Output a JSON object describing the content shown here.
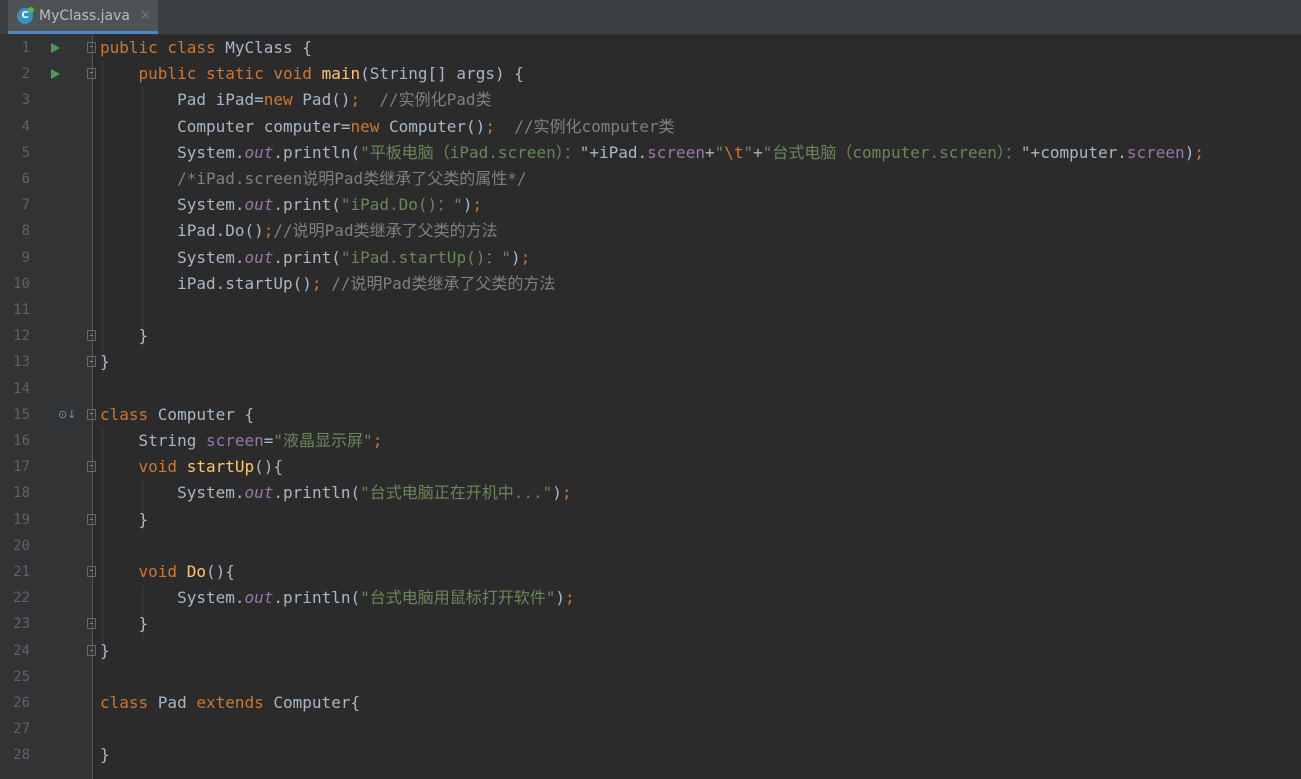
{
  "tab": {
    "label": "MyClass.java",
    "close": "×",
    "icon_letter": "C"
  },
  "colors": {
    "keyword": "#cc7832",
    "string": "#6a8759",
    "comment": "#808080",
    "field": "#9876aa",
    "method": "#ffc66d",
    "escape": "#cc7832",
    "default": "#a9b7c6"
  },
  "lines": [
    {
      "num": "1",
      "gutter": "run",
      "fold": "open",
      "tokens": [
        [
          "kw",
          "public class "
        ],
        [
          "d",
          "MyClass {"
        ]
      ]
    },
    {
      "num": "2",
      "gutter": "run",
      "fold": "open",
      "tokens": [
        [
          "d",
          "    "
        ],
        [
          "kw",
          "public static void "
        ],
        [
          "m",
          "main"
        ],
        [
          "d",
          "(String[] args) {"
        ]
      ]
    },
    {
      "num": "3",
      "tokens": [
        [
          "d",
          "        Pad iPad="
        ],
        [
          "kw",
          "new "
        ],
        [
          "d",
          "Pad()"
        ],
        [
          "kw",
          ";"
        ],
        [
          "d",
          "  "
        ],
        [
          "c",
          "//实例化Pad类"
        ]
      ]
    },
    {
      "num": "4",
      "tokens": [
        [
          "d",
          "        Computer computer="
        ],
        [
          "kw",
          "new "
        ],
        [
          "d",
          "Computer()"
        ],
        [
          "kw",
          ";"
        ],
        [
          "d",
          "  "
        ],
        [
          "c",
          "//实例化computer类"
        ]
      ]
    },
    {
      "num": "5",
      "tokens": [
        [
          "d",
          "        System."
        ],
        [
          "fi",
          "out"
        ],
        [
          "d",
          ".println("
        ],
        [
          "s",
          "\"平板电脑（iPad.screen）："
        ],
        [
          "d",
          "\"+iPad."
        ],
        [
          "f",
          "screen"
        ],
        [
          "d",
          "+"
        ],
        [
          "s",
          "\""
        ],
        [
          "e",
          "\\t"
        ],
        [
          "s",
          "\""
        ],
        [
          "d",
          "+"
        ],
        [
          "s",
          "\"台式电脑（computer.screen）："
        ],
        [
          "d",
          "\"+computer."
        ],
        [
          "f",
          "screen"
        ],
        [
          "d",
          ")"
        ],
        [
          "kw",
          ";"
        ]
      ]
    },
    {
      "num": "6",
      "tokens": [
        [
          "d",
          "        "
        ],
        [
          "c",
          "/*iPad.screen说明Pad类继承了父类的属性*/"
        ]
      ]
    },
    {
      "num": "7",
      "tokens": [
        [
          "d",
          "        System."
        ],
        [
          "fi",
          "out"
        ],
        [
          "d",
          ".print("
        ],
        [
          "s",
          "\"iPad.Do()：\""
        ],
        [
          "d",
          ")"
        ],
        [
          "kw",
          ";"
        ]
      ]
    },
    {
      "num": "8",
      "tokens": [
        [
          "d",
          "        iPad.Do()"
        ],
        [
          "kw",
          ";"
        ],
        [
          "c",
          "//说明Pad类继承了父类的方法"
        ]
      ]
    },
    {
      "num": "9",
      "tokens": [
        [
          "d",
          "        System."
        ],
        [
          "fi",
          "out"
        ],
        [
          "d",
          ".print("
        ],
        [
          "s",
          "\"iPad.startUp()：\""
        ],
        [
          "d",
          ")"
        ],
        [
          "kw",
          ";"
        ]
      ]
    },
    {
      "num": "10",
      "tokens": [
        [
          "d",
          "        iPad.startUp()"
        ],
        [
          "kw",
          ";"
        ],
        [
          "d",
          " "
        ],
        [
          "c",
          "//说明Pad类继承了父类的方法"
        ]
      ]
    },
    {
      "num": "11",
      "tokens": []
    },
    {
      "num": "12",
      "fold": "close",
      "tokens": [
        [
          "d",
          "    }"
        ]
      ]
    },
    {
      "num": "13",
      "fold": "close",
      "tokens": [
        [
          "d",
          "}"
        ]
      ]
    },
    {
      "num": "14",
      "tokens": []
    },
    {
      "num": "15",
      "gutter": "override",
      "fold": "open",
      "tokens": [
        [
          "kw",
          "class "
        ],
        [
          "d",
          "Computer {"
        ]
      ]
    },
    {
      "num": "16",
      "tokens": [
        [
          "d",
          "    String "
        ],
        [
          "f",
          "screen"
        ],
        [
          "d",
          "="
        ],
        [
          "s",
          "\"液晶显示屏\""
        ],
        [
          "kw",
          ";"
        ]
      ]
    },
    {
      "num": "17",
      "fold": "open",
      "tokens": [
        [
          "d",
          "    "
        ],
        [
          "kw",
          "void "
        ],
        [
          "m",
          "startUp"
        ],
        [
          "d",
          "(){"
        ]
      ]
    },
    {
      "num": "18",
      "tokens": [
        [
          "d",
          "        System."
        ],
        [
          "fi",
          "out"
        ],
        [
          "d",
          ".println("
        ],
        [
          "s",
          "\"台式电脑正在开机中...\""
        ],
        [
          "d",
          ")"
        ],
        [
          "kw",
          ";"
        ]
      ]
    },
    {
      "num": "19",
      "fold": "close",
      "tokens": [
        [
          "d",
          "    }"
        ]
      ]
    },
    {
      "num": "20",
      "tokens": []
    },
    {
      "num": "21",
      "fold": "open",
      "tokens": [
        [
          "d",
          "    "
        ],
        [
          "kw",
          "void "
        ],
        [
          "m",
          "Do"
        ],
        [
          "d",
          "(){"
        ]
      ]
    },
    {
      "num": "22",
      "tokens": [
        [
          "d",
          "        System."
        ],
        [
          "fi",
          "out"
        ],
        [
          "d",
          ".println("
        ],
        [
          "s",
          "\"台式电脑用鼠标打开软件\""
        ],
        [
          "d",
          ")"
        ],
        [
          "kw",
          ";"
        ]
      ]
    },
    {
      "num": "23",
      "fold": "close",
      "tokens": [
        [
          "d",
          "    }"
        ]
      ]
    },
    {
      "num": "24",
      "fold": "close",
      "tokens": [
        [
          "d",
          "}"
        ]
      ]
    },
    {
      "num": "25",
      "tokens": []
    },
    {
      "num": "26",
      "tokens": [
        [
          "kw",
          "class "
        ],
        [
          "d",
          "Pad "
        ],
        [
          "kw",
          "extends "
        ],
        [
          "d",
          "Computer{"
        ]
      ]
    },
    {
      "num": "27",
      "tokens": []
    },
    {
      "num": "28",
      "tokens": [
        [
          "d",
          "}"
        ]
      ]
    }
  ]
}
